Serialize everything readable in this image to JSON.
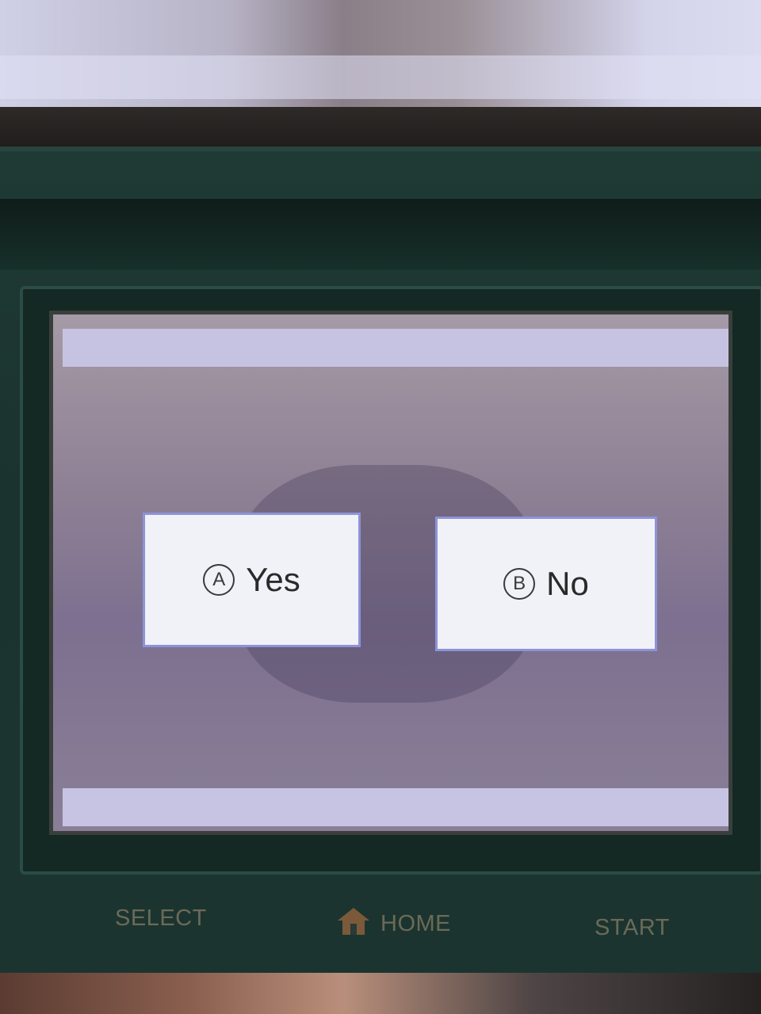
{
  "dialog": {
    "yes_button": {
      "glyph": "A",
      "label": "Yes"
    },
    "no_button": {
      "glyph": "B",
      "label": "No"
    }
  },
  "hardware": {
    "select_label": "SELECT",
    "home_label": "HOME",
    "home_icon": "house-icon",
    "start_label": "START"
  },
  "colors": {
    "button_fill": "#f1f1f8",
    "button_border": "#8d93d8",
    "device_body": "#1f3a35",
    "hardware_label": "#6b6a58"
  }
}
